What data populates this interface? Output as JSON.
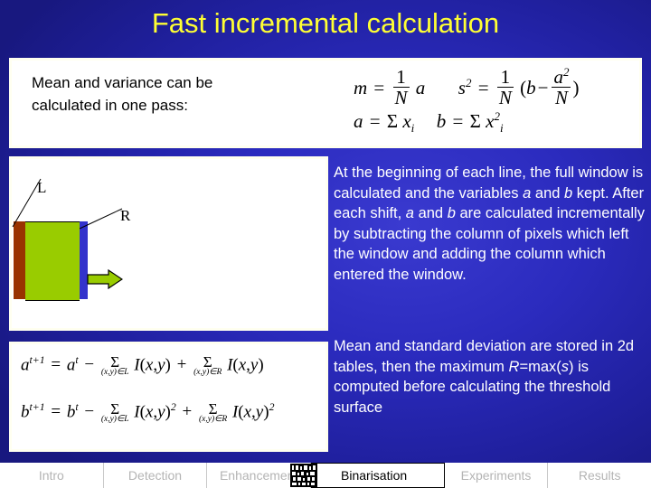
{
  "slide": {
    "title": "Fast incremental calculation",
    "accent_title_color": "#ffff33",
    "background_color": "#2222aa",
    "panel_color": "#ffffff",
    "panel_border_color": "#fffff0"
  },
  "stats_panel": {
    "text_line1": "Mean and variance can be",
    "text_line2": "calculated in one pass:",
    "formulas": {
      "mean": "m = (1/N) a",
      "variance": "s² = (1/N)(b − a²/N)",
      "a_def": "a = Σ x_i",
      "b_def": "b = Σ x_i²",
      "m": "m",
      "s": "s",
      "a": "a",
      "b": "b",
      "N": "N",
      "one": "1",
      "two": "2",
      "equals": "=",
      "minus": "−",
      "sigma": "Σ",
      "x": "x",
      "i": "i",
      "lparen": "(",
      "rparen": ")"
    }
  },
  "diagram": {
    "label_left": "L",
    "label_right": "R",
    "left_column_color": "#993300",
    "window_color": "#99cc00",
    "right_column_color": "#3333cc",
    "arrow_color": "#99cc00",
    "arrow_outline_color": "#000000"
  },
  "incremental_formulas": {
    "row_a": "a^{t+1} = a^t − Σ_{(x,y)∈L} I(x,y) + Σ_{(x,y)∈R} I(x,y)",
    "row_b": "b^{t+1} = b^t − Σ_{(x,y)∈L} I(x,y)² + Σ_{(x,y)∈R} I(x,y)²",
    "tokens": {
      "a": "a",
      "b": "b",
      "t_plus_1": "t+1",
      "t": "t",
      "equals": "=",
      "minus": "−",
      "plus": "+",
      "sigma": "Σ",
      "limit_L": "(x,y)∈L",
      "limit_R": "(x,y)∈R",
      "I": "I",
      "lparen": "(",
      "x": "x",
      "comma": ",",
      "y": "y",
      "rparen": ")",
      "square": "2"
    }
  },
  "body": {
    "paragraph_1": {
      "part_1": "At the beginning of each line, the full window is calculated and the variables ",
      "em_a": "a",
      "part_2": " and ",
      "em_b": "b",
      "part_3": " kept. After each shift, ",
      "em_a2": "a",
      "part_4": " and ",
      "em_b2": "b",
      "part_5": " are calculated incrementally by subtracting the column of pixels which left the window and adding the column which entered the window."
    },
    "paragraph_2": {
      "part_1": "Mean and standard deviation are stored in 2d tables, then the maximum ",
      "em_R": "R",
      "part_2": "=max(",
      "em_s": "s",
      "part_3": ") is computed before calculating the threshold surface"
    }
  },
  "navbar": {
    "tabs": [
      {
        "label": "Intro",
        "active": false
      },
      {
        "label": "Detection",
        "active": false
      },
      {
        "label": "Enhancement",
        "active": false
      },
      {
        "label": "Binarisation",
        "active": true
      },
      {
        "label": "Experiments",
        "active": false
      },
      {
        "label": "Results",
        "active": false
      }
    ],
    "active_tab_icon": "binarised-thumbnail-icon"
  }
}
